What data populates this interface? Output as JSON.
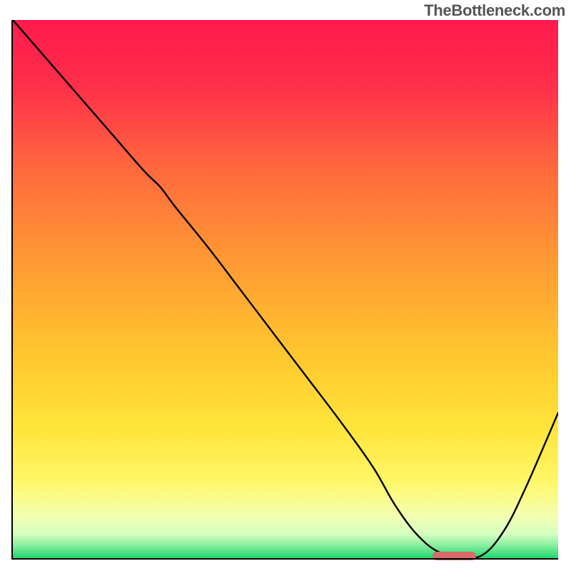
{
  "watermark": "TheBottleneck.com",
  "colors": {
    "curve": "#000000",
    "pill": "#d86a6a",
    "axis": "#000000",
    "gradient": [
      {
        "pct": 0,
        "hex": "#ff1a4d"
      },
      {
        "pct": 12,
        "hex": "#ff2e4a"
      },
      {
        "pct": 28,
        "hex": "#ff6a3d"
      },
      {
        "pct": 45,
        "hex": "#ff9a33"
      },
      {
        "pct": 62,
        "hex": "#ffc62e"
      },
      {
        "pct": 76,
        "hex": "#ffe53a"
      },
      {
        "pct": 86,
        "hex": "#fff76a"
      },
      {
        "pct": 92,
        "hex": "#f3ffb0"
      },
      {
        "pct": 95.5,
        "hex": "#d6ffc0"
      },
      {
        "pct": 97.5,
        "hex": "#8ef0a0"
      },
      {
        "pct": 100,
        "hex": "#1fd66f"
      }
    ]
  },
  "chart_data": {
    "type": "line",
    "title": "",
    "xlabel": "",
    "ylabel": "",
    "xlim": [
      0,
      100
    ],
    "ylim": [
      0,
      100
    ],
    "x": [
      0,
      6,
      12,
      18,
      24,
      27,
      30,
      36,
      42,
      48,
      54,
      60,
      66,
      70,
      74,
      78,
      82,
      86,
      90,
      94,
      100
    ],
    "values": [
      100,
      93,
      86,
      79,
      72,
      69,
      65,
      57.5,
      49.5,
      41.5,
      33.5,
      25.5,
      17,
      10,
      4.5,
      1.2,
      0.4,
      0.5,
      5,
      13,
      27
    ],
    "sweet_spot": {
      "x_start": 77,
      "x_end": 85,
      "y": 0.4
    },
    "annotations": []
  }
}
